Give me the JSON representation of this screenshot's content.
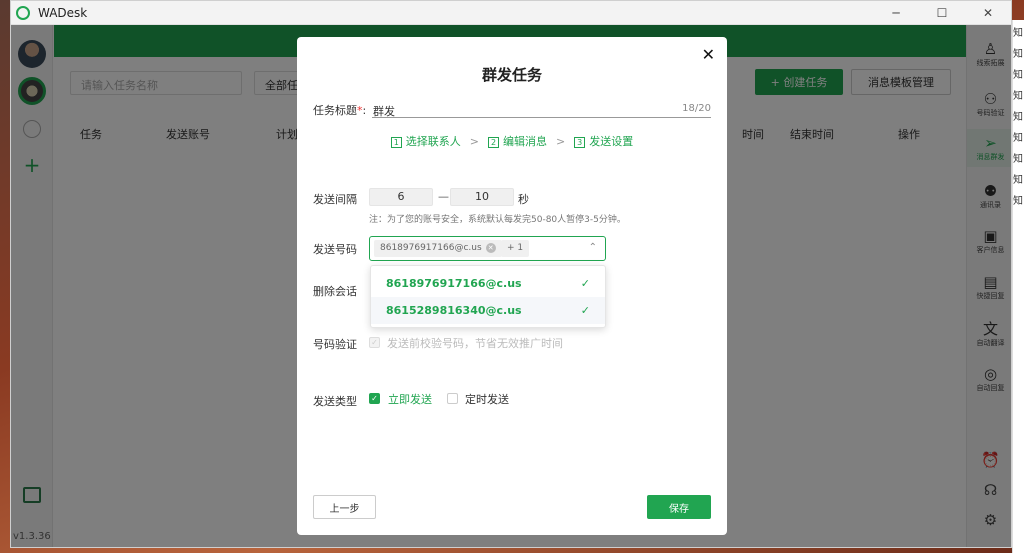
{
  "window": {
    "title": "WADesk",
    "minimize": "─",
    "maximize": "☐",
    "close": "✕"
  },
  "left_sidebar": {
    "add": "+",
    "version": "v1.3.36"
  },
  "right_sidebar": {
    "items": [
      {
        "label": "线索拓展",
        "icon": "person-plus-icon",
        "glyph": "♙"
      },
      {
        "label": "号码验证",
        "icon": "user-search-icon",
        "glyph": "⚇"
      },
      {
        "label": "消息群发",
        "icon": "paper-plane-icon",
        "glyph": "➢"
      },
      {
        "label": "通讯录",
        "icon": "contacts-icon",
        "glyph": "⚉"
      },
      {
        "label": "客户信息",
        "icon": "customer-card-icon",
        "glyph": "▣"
      },
      {
        "label": "快捷回复",
        "icon": "chat-bubble-icon",
        "glyph": "▤"
      },
      {
        "label": "自动翻译",
        "icon": "translate-icon",
        "glyph": "文"
      },
      {
        "label": "自动回复",
        "icon": "auto-reply-icon",
        "glyph": "◎"
      }
    ],
    "bottom": [
      {
        "icon": "alarm-icon",
        "glyph": "⏰"
      },
      {
        "icon": "headset-icon",
        "glyph": "☊"
      },
      {
        "icon": "gear-icon",
        "glyph": "⚙"
      }
    ]
  },
  "background": {
    "search_placeholder": "请输入任务名称",
    "filter_label": "全部任",
    "create_button": "+ 创建任务",
    "template_button": "消息模板管理",
    "columns": [
      "任务",
      "发送账号",
      "计划",
      "时间",
      "结束时间",
      "操作"
    ]
  },
  "modal": {
    "title": "群发任务",
    "close": "✕",
    "task_title_label": "任务标题",
    "required_mark": "*",
    "label_colon": ":",
    "task_title_value": "群发",
    "task_title_counter": "18/20",
    "steps": [
      {
        "num": "1",
        "label": "选择联系人"
      },
      {
        "num": "2",
        "label": "编辑消息"
      },
      {
        "num": "3",
        "label": "发送设置"
      }
    ],
    "step_separator": ">",
    "interval_label": "发送间隔",
    "interval_min": "6",
    "interval_dash": "—",
    "interval_max": "10",
    "interval_unit": "秒",
    "interval_note": "注：为了您的账号安全，系统默认每发完50-80人暂停3-5分钟。",
    "phone_label": "发送号码",
    "phone_tag": "8618976917166@c.us",
    "phone_tag_more": "+ 1",
    "phone_options": [
      "8618976917166@c.us",
      "8615289816340@c.us"
    ],
    "delete_session_label": "删除会话",
    "verify_label": "号码验证",
    "verify_option": "发送前校验号码，节省无效推广时间",
    "send_type_label": "发送类型",
    "send_now": "立即发送",
    "send_scheduled": "定时发送",
    "prev_button": "上一步",
    "save_button": "保存"
  },
  "side_edge_chars": [
    "知",
    "知",
    "知",
    "知",
    "知",
    "知",
    "知",
    "知",
    "知"
  ],
  "colors": {
    "accent": "#21a551",
    "mask": "rgba(0,0,0,0.5)"
  }
}
